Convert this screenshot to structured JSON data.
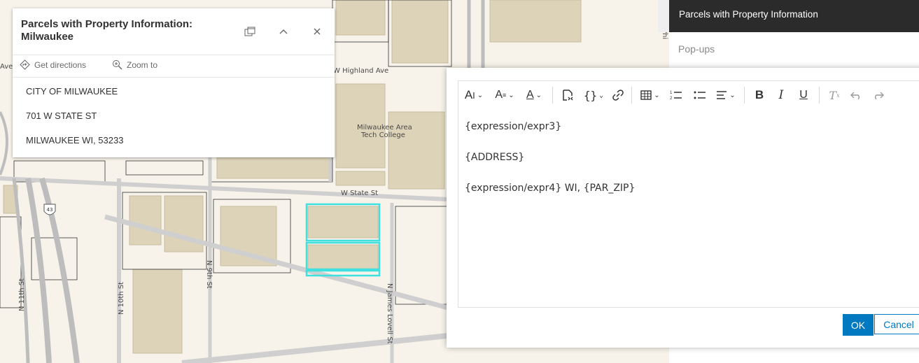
{
  "map": {
    "streets": {
      "w_highland_ave": "W Highland Ave",
      "w_state_st": "W State St",
      "n_11th_st": "N 11th St",
      "n_10th_st": "N 10th St",
      "n_9th_st": "N 9th St",
      "n_james_lovell_st": "N James Lovell St",
      "n_vel_r_phi": "N Vel R Phi",
      "ave_fragment": "Ave",
      "th_fragment": "th"
    },
    "poi_line1": "Milwaukee Area",
    "poi_line2": "Tech College",
    "highway_shield": "43",
    "highlight_color": "#3fe0e0"
  },
  "popup": {
    "title": "Parcels with Property Information: Milwaukee",
    "dock_icon": "dock-icon",
    "collapse_icon": "chevron-up-icon",
    "close_icon": "close-icon",
    "actions": {
      "directions": "Get directions",
      "zoom": "Zoom to"
    },
    "lines": [
      "CITY OF MILWAUKEE",
      "701 W STATE ST",
      "MILWAUKEE WI, 53233"
    ]
  },
  "side_panel": {
    "title": "Parcels with Property Information",
    "subtitle": "Pop-ups"
  },
  "editor": {
    "toolbar_icons": [
      "font-size-icon",
      "font-family-icon",
      "font-color-icon",
      "insert-content-icon",
      "expression-braces-icon",
      "link-icon",
      "table-icon",
      "numbered-list-icon",
      "bulleted-list-icon",
      "align-icon",
      "bold-icon",
      "italic-icon",
      "underline-icon",
      "clear-format-icon",
      "undo-icon",
      "redo-icon"
    ],
    "content": [
      "{expression/expr3}",
      "{ADDRESS}",
      "{expression/expr4} WI, {PAR_ZIP}"
    ],
    "ok_label": "OK",
    "cancel_label": "Cancel",
    "accent_color": "#0079c1"
  }
}
